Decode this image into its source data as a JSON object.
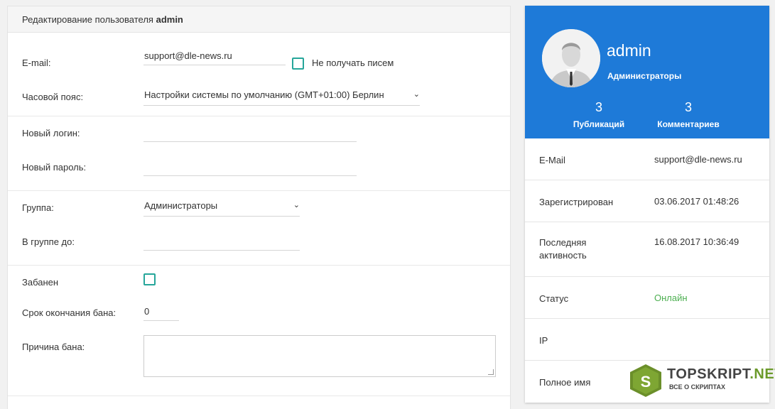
{
  "header": {
    "title_prefix": "Редактирование пользователя",
    "title_user": "admin"
  },
  "form": {
    "email_label": "E-mail:",
    "email_value": "support@dle-news.ru",
    "no_mail_label": "Не получать писем",
    "timezone_label": "Часовой пояс:",
    "timezone_value": "Настройки системы по умолчанию (GMT+01:00) Берлин",
    "new_login_label": "Новый логин:",
    "new_password_label": "Новый пароль:",
    "group_label": "Группа:",
    "group_value": "Администраторы",
    "group_until_label": "В группе до:",
    "banned_label": "Забанен",
    "ban_end_label": "Срок окончания бана:",
    "ban_end_value": "0",
    "ban_reason_label": "Причина бана:"
  },
  "profile": {
    "username": "admin",
    "group": "Администраторы",
    "publications_count": "3",
    "publications_label": "Публикаций",
    "comments_count": "3",
    "comments_label": "Комментариев",
    "accent_color": "#1e7ad8"
  },
  "info": [
    {
      "key": "E-Mail",
      "value": "support@dle-news.ru"
    },
    {
      "key": "Зарегистрирован",
      "value": "03.06.2017 01:48:26"
    },
    {
      "key_line1": "Последняя",
      "key_line2": "активность",
      "value": "16.08.2017 10:36:49"
    },
    {
      "key": "Статус",
      "value": "Онлайн",
      "value_color": "#4caf50"
    },
    {
      "key": "IP",
      "value": ""
    },
    {
      "key": "Полное имя",
      "value": ""
    }
  ],
  "watermark": {
    "title": "TOPSKRIPT",
    "title_suffix": ".NET",
    "subtitle": "ВСЕ О СКРИПТАХ",
    "logo_letter": "S"
  }
}
